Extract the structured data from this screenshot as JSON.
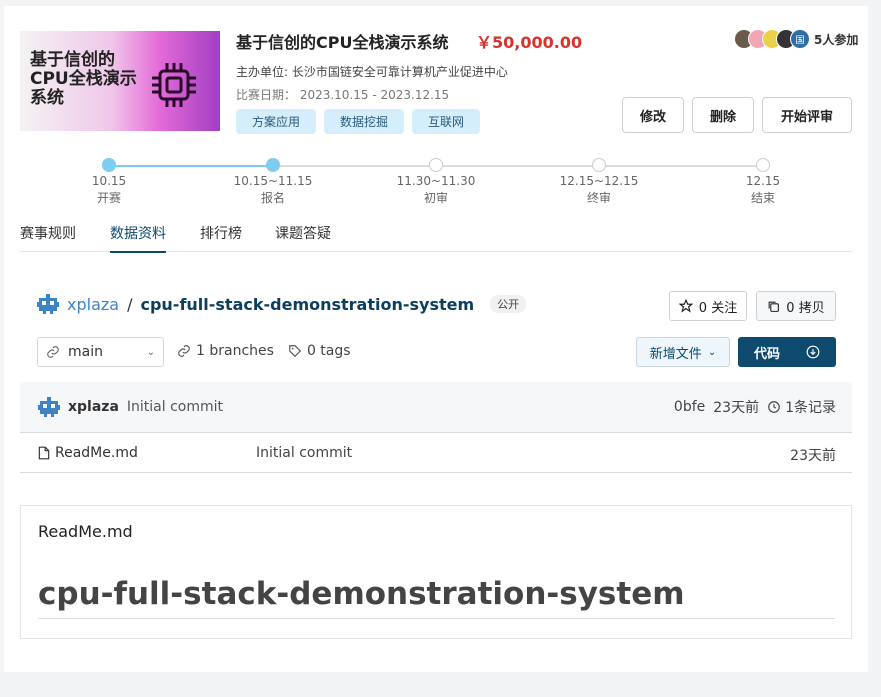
{
  "competition": {
    "banner_text": "基于信创的CPU全栈演示系统",
    "title": "基于信创的CPU全栈演示系统",
    "prize": "￥50,000.00",
    "organizer": "主办单位: 长沙市国链安全可靠计算机产业促进中心",
    "dates": "比赛日期： 2023.10.15 - 2023.12.15",
    "tags": [
      "方案应用",
      "数据挖掘",
      "互联网"
    ],
    "participants_count": "5人参加",
    "participant_avatar_letter": "国",
    "actions": {
      "edit": "修改",
      "delete": "删除",
      "review": "开始评审"
    }
  },
  "timeline": [
    {
      "date": "10.15",
      "label": "开赛",
      "completed": true
    },
    {
      "date": "10.15~11.15",
      "label": "报名",
      "completed": true
    },
    {
      "date": "11.30~11.30",
      "label": "初审",
      "completed": false
    },
    {
      "date": "12.15~12.15",
      "label": "终审",
      "completed": false
    },
    {
      "date": "12.15",
      "label": "结束",
      "completed": false
    }
  ],
  "tabs": [
    {
      "label": "赛事规则",
      "active": false
    },
    {
      "label": "数据资料",
      "active": true
    },
    {
      "label": "排行榜",
      "active": false
    },
    {
      "label": "课题答疑",
      "active": false
    }
  ],
  "repo": {
    "owner": "xplaza",
    "separator": "/",
    "name": "cpu-full-stack-demonstration-system",
    "visibility": "公开",
    "star_label": "0 关注",
    "fork_label": "0 拷贝",
    "branch": "main",
    "branches": "1 branches",
    "tags": "0 tags",
    "new_file": "新增文件",
    "code": "代码"
  },
  "commit": {
    "author": "xplaza",
    "message": "Initial commit",
    "hash": "0bfe",
    "time": "23天前",
    "count": "1条记录"
  },
  "files": [
    {
      "name": "ReadMe.md",
      "commit": "Initial commit",
      "time": "23天前"
    }
  ],
  "readme": {
    "file_name": "ReadMe.md",
    "heading": "cpu-full-stack-demonstration-system"
  },
  "colors": {
    "accent": "#0d4a6e",
    "price": "#d9312c",
    "link": "#3e84c5",
    "timeline_done": "#7dcdf0",
    "tag_bg": "#d4eefc"
  }
}
